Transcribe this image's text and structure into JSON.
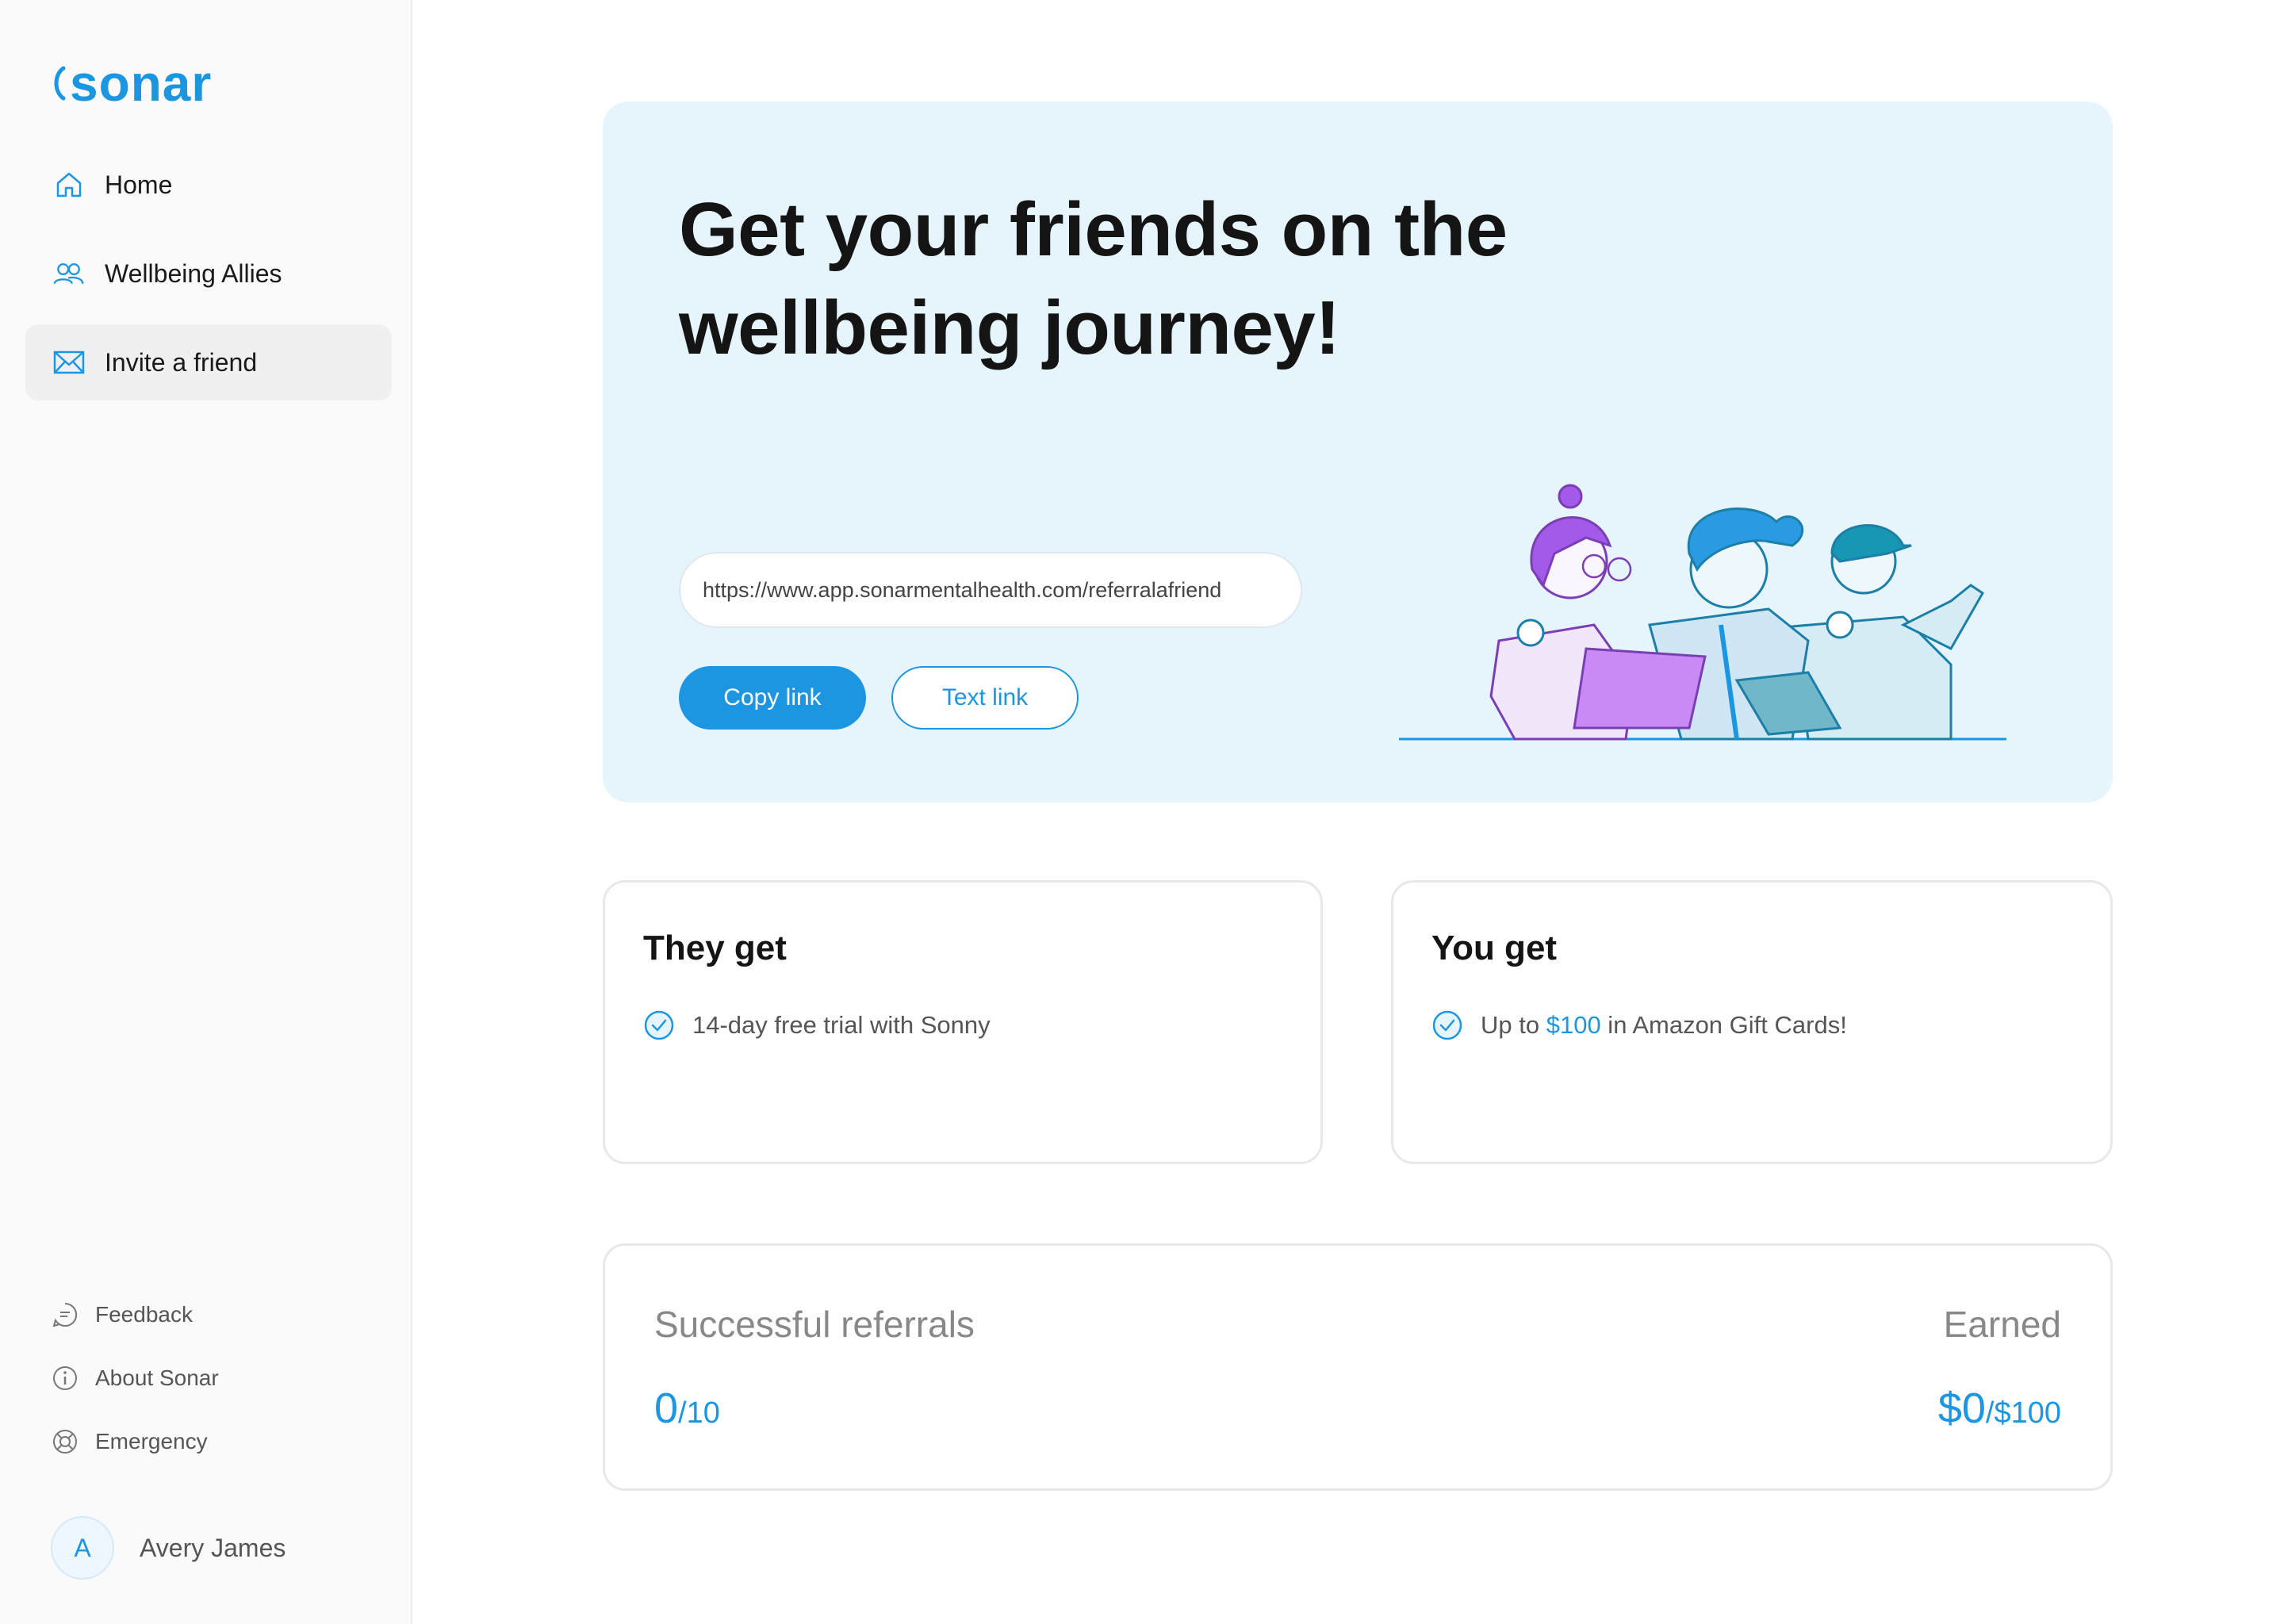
{
  "brand": {
    "name": "sonar",
    "color": "#1c96e0"
  },
  "sidebar": {
    "nav": [
      {
        "label": "Home",
        "icon": "home-icon"
      },
      {
        "label": "Wellbeing Allies",
        "icon": "users-icon"
      },
      {
        "label": "Invite a friend",
        "icon": "mail-icon",
        "active": true
      }
    ],
    "bottom_links": [
      {
        "label": "Feedback",
        "icon": "chat-icon"
      },
      {
        "label": "About Sonar",
        "icon": "info-icon"
      },
      {
        "label": "Emergency",
        "icon": "lifebuoy-icon"
      }
    ],
    "user": {
      "initial": "A",
      "name": "Avery James"
    }
  },
  "hero": {
    "title": "Get your friends on the wellbeing journey!",
    "link": "https://www.app.sonarmentalhealth.com/referralafriend",
    "copy_label": "Copy link",
    "text_label": "Text link"
  },
  "they_get": {
    "title": "They get",
    "item": "14-day free trial with Sonny"
  },
  "you_get": {
    "title": "You get",
    "prefix": "Up to ",
    "amount": "$100",
    "suffix": " in Amazon Gift Cards!"
  },
  "stats": {
    "referrals_label": "Successful referrals",
    "referrals_count": "0",
    "referrals_total": "/10",
    "earned_label": "Earned",
    "earned_amount": "$0",
    "earned_total": "/$100"
  }
}
